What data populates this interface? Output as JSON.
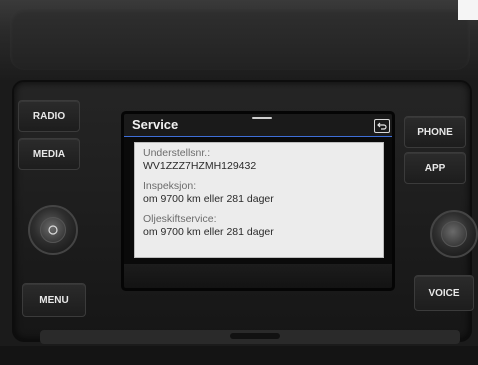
{
  "buttons": {
    "radio": "RADIO",
    "media": "MEDIA",
    "menu": "MENU",
    "phone": "PHONE",
    "app": "APP",
    "voice": "VOICE"
  },
  "screen": {
    "title": "Service",
    "info": [
      {
        "label": "Understellsnr.:",
        "value": "WV1ZZZ7HZMH129432"
      },
      {
        "label": "Inspeksjon:",
        "value": "om 9700 km eller 281 dager"
      },
      {
        "label": "Oljeskiftservice:",
        "value": "om 9700 km eller 281 dager"
      }
    ]
  },
  "colors": {
    "accent": "#3f6fd8",
    "panel_bg": "#ececec"
  },
  "icons": {
    "back": "back-arrow-icon",
    "knob": "power-knob-icon"
  }
}
